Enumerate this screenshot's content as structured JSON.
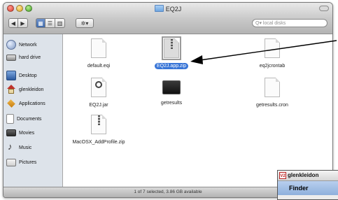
{
  "window": {
    "title": "EQ2J"
  },
  "toolbar": {
    "back_label": "◀",
    "forward_label": "▶",
    "view_icons": "▦",
    "view_list": "☰",
    "view_columns": "▥",
    "action_label": "✲▾",
    "search_placeholder": "Q▾ local disks"
  },
  "sidebar": {
    "items": [
      {
        "label": "Network",
        "icon": "globe-icon"
      },
      {
        "label": "hard drive",
        "icon": "hard-drive-icon"
      },
      {
        "label": "Desktop",
        "icon": "desktop-icon"
      },
      {
        "label": "glenkleidon",
        "icon": "home-icon"
      },
      {
        "label": "Applications",
        "icon": "applications-icon"
      },
      {
        "label": "Documents",
        "icon": "documents-icon"
      },
      {
        "label": "Movies",
        "icon": "movies-icon"
      },
      {
        "label": "Music",
        "icon": "music-icon"
      },
      {
        "label": "Pictures",
        "icon": "pictures-icon"
      }
    ]
  },
  "files": [
    {
      "name": "default.eqi",
      "kind": "document",
      "selected": false
    },
    {
      "name": "EQ2J.app.zip",
      "kind": "zip",
      "selected": true
    },
    {
      "name": "eq2jcrontab",
      "kind": "document",
      "selected": false
    },
    {
      "name": "EQ2J.jar",
      "kind": "jar",
      "selected": false
    },
    {
      "name": "getresults",
      "kind": "terminal",
      "selected": false
    },
    {
      "name": "getresults.cron",
      "kind": "document",
      "selected": false
    },
    {
      "name": "MacOSX_AddProfile.zip",
      "kind": "zip",
      "selected": false
    }
  ],
  "status": {
    "text": "1 of 7 selected, 3.86 GB available"
  },
  "overlay_window": {
    "title": "glenkleidon",
    "vnc_badge": "V2",
    "menu_app": "Finder"
  },
  "colors": {
    "selection": "#3875d7",
    "sidebar_bg": "#dde3ea"
  }
}
